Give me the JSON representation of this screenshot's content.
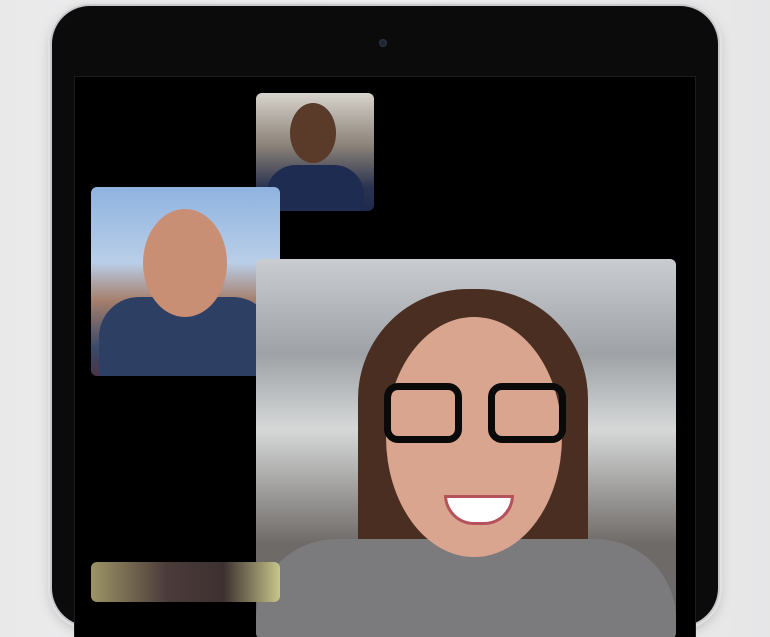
{
  "app": {
    "name_hidden": false
  },
  "participants": [
    {
      "id": "participant-top-small",
      "video": "man-smiling"
    },
    {
      "id": "participant-left",
      "video": "young-man-smiling"
    },
    {
      "id": "participant-main",
      "video": "woman-glasses-smiling"
    },
    {
      "id": "participant-bottom",
      "video": "partial"
    }
  ],
  "colors": {
    "screen": "#000000",
    "bezel": "#0b0b0c"
  }
}
